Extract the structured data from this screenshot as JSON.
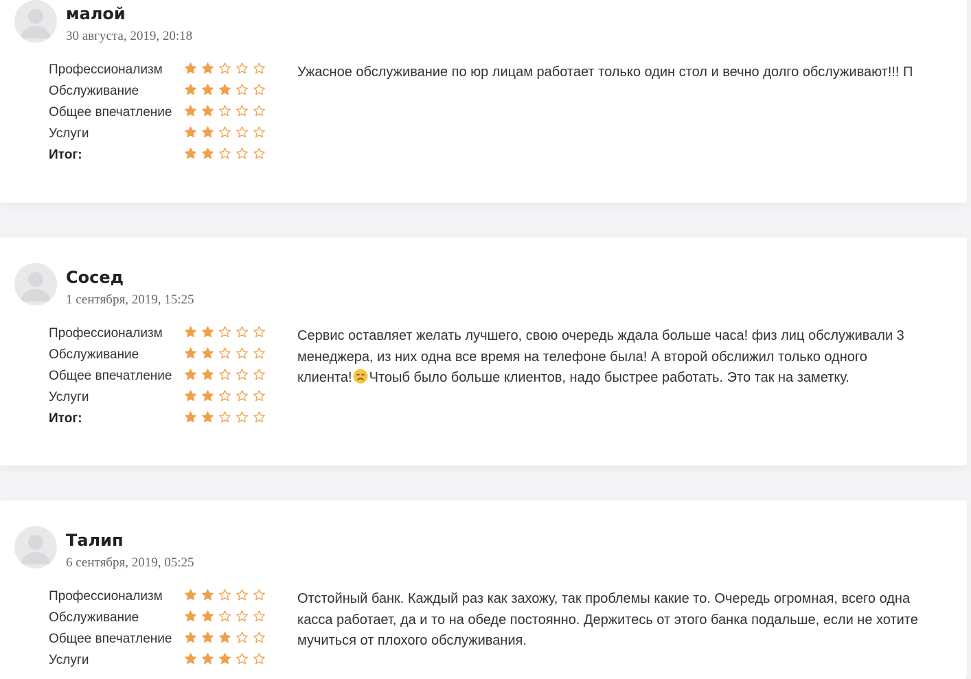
{
  "colors": {
    "star_filled": "#f0a04b",
    "star_empty_outline": "#f0a04b",
    "avatar_bg": "#e9e9eb",
    "avatar_figure": "#dadadc"
  },
  "rating_labels": {
    "professionalism": "Профессионализм",
    "service": "Обслуживание",
    "impression": "Общее впечатление",
    "services": "Услуги",
    "total": "Итог:"
  },
  "icons": {
    "avatar": "user-placeholder-icon",
    "star_filled": "star-filled-icon",
    "star_empty": "star-outline-icon",
    "emoji": "disappointed-face-icon"
  },
  "reviews": [
    {
      "author": "малой",
      "date": "30 августа, 2019, 20:18",
      "ratings": {
        "professionalism": 2,
        "service": 3,
        "impression": 2,
        "services": 2,
        "total": 2
      },
      "text": "Ужасное обслуживание по юр лицам работает только один стол и вечно долго обслуживают!!! П"
    },
    {
      "author": "Сосед",
      "date": "1 сентября, 2019, 15:25",
      "ratings": {
        "professionalism": 2,
        "service": 2,
        "impression": 2,
        "services": 2,
        "total": 2
      },
      "text_line1": "Сервис оставляет желать лучшего, свою очередь ждала больше часа! физ лиц обслуживали 3",
      "text_line2": "менеджера, из них одна все время на телефоне была! А второй обслижил только одного",
      "text_line3a": "клиента!",
      "text_line3b": "Чтоыб было больше клиентов, надо быстрее работать. Это так на заметку."
    },
    {
      "author": "Талип",
      "date": "6 сентября, 2019, 05:25",
      "ratings": {
        "professionalism": 2,
        "service": 2,
        "impression": 3,
        "services": 3
      },
      "text_line1": "Отстойный банк. Каждый раз как захожу, так проблемы какие то. Очередь огромная, всего одна",
      "text_line2": "касса работает, да и то на обеде постоянно. Держитесь от этого банка подальше, если не хотите",
      "text_line3": "мучиться от плохого обслуживания."
    }
  ]
}
